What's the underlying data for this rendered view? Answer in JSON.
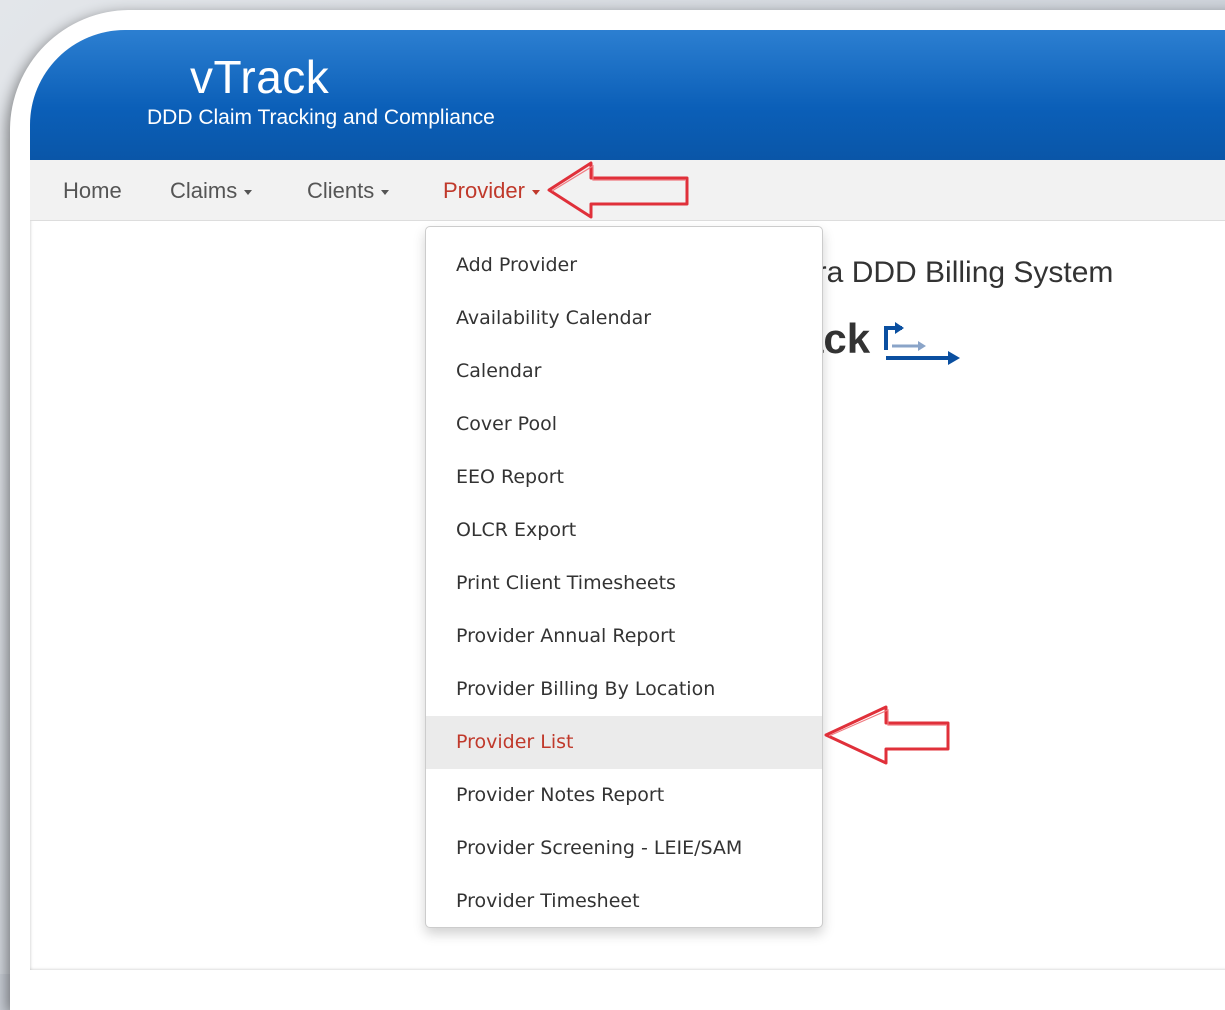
{
  "app": {
    "title": "vTrack",
    "subtitle": "DDD Claim Tracking and Compliance"
  },
  "nav": {
    "home": "Home",
    "claims": "Claims",
    "clients": "Clients",
    "provider": "Provider"
  },
  "page": {
    "welcome_fragment": "hra DDD Billing System",
    "logo_fragment": "ack"
  },
  "dropdown": {
    "items": [
      {
        "label": "Add Provider"
      },
      {
        "label": "Availability Calendar"
      },
      {
        "label": "Calendar"
      },
      {
        "label": "Cover Pool"
      },
      {
        "label": "EEO Report"
      },
      {
        "label": "OLCR Export"
      },
      {
        "label": "Print Client Timesheets"
      },
      {
        "label": "Provider Annual Report"
      },
      {
        "label": "Provider Billing By Location"
      },
      {
        "label": "Provider List"
      },
      {
        "label": "Provider Notes Report"
      },
      {
        "label": "Provider Screening - LEIE/SAM"
      },
      {
        "label": "Provider Timesheet"
      }
    ],
    "highlighted": "Provider List"
  },
  "colors": {
    "header_blue": "#0b5fb8",
    "active_red": "#c0392b",
    "annotation_red": "#e0303a",
    "logo_blue": "#0a4fa0"
  },
  "icons": {
    "annotation_arrow": "left-arrow-outline",
    "logo_mark": "arrows-logo-icon"
  }
}
